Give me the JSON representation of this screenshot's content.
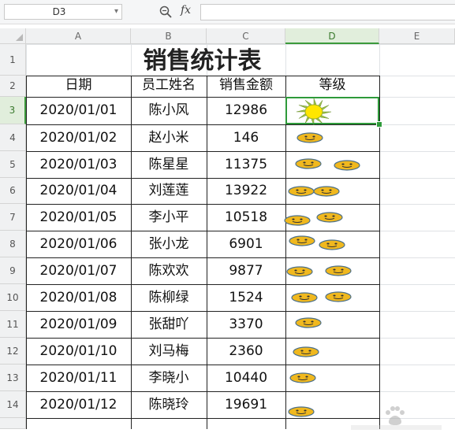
{
  "formula_bar": {
    "name_box": "D3",
    "fx_label": "fx",
    "formula_value": ""
  },
  "columns": [
    "A",
    "B",
    "C",
    "D",
    "E"
  ],
  "row_numbers": [
    "1",
    "2",
    "3",
    "4",
    "5",
    "6",
    "7",
    "8",
    "9",
    "10",
    "11",
    "12",
    "13",
    "14"
  ],
  "sheet": {
    "title": "销售统计表",
    "headers": [
      "日期",
      "员工姓名",
      "销售金额",
      "等级"
    ],
    "rows": [
      {
        "date": "2020/01/01",
        "name": "陈小风",
        "amount": "12986"
      },
      {
        "date": "2020/01/02",
        "name": "赵小米",
        "amount": "146"
      },
      {
        "date": "2020/01/03",
        "name": "陈星星",
        "amount": "11375"
      },
      {
        "date": "2020/01/04",
        "name": "刘莲莲",
        "amount": "13922"
      },
      {
        "date": "2020/01/05",
        "name": "李小平",
        "amount": "10518"
      },
      {
        "date": "2020/01/06",
        "name": "张小龙",
        "amount": "6901"
      },
      {
        "date": "2020/01/07",
        "name": "陈欢欢",
        "amount": "9877"
      },
      {
        "date": "2020/01/08",
        "name": "陈柳绿",
        "amount": "1524"
      },
      {
        "date": "2020/01/09",
        "name": "张甜吖",
        "amount": "3370"
      },
      {
        "date": "2020/01/10",
        "name": "刘马梅",
        "amount": "2360"
      },
      {
        "date": "2020/01/11",
        "name": "李晓小",
        "amount": "10440"
      },
      {
        "date": "2020/01/12",
        "name": "陈晓玲",
        "amount": "19691"
      }
    ],
    "grade_shapes": [
      [
        "sun"
      ],
      [
        "smiley"
      ],
      [
        "smiley",
        "smiley"
      ],
      [
        "smiley",
        "smiley"
      ],
      [
        "smiley",
        "smiley"
      ],
      [
        "smiley",
        "smiley"
      ],
      [
        "smiley",
        "smiley"
      ],
      [
        "smiley",
        "smiley"
      ],
      [
        "smiley"
      ],
      [
        "smiley"
      ],
      [
        "smiley"
      ],
      [
        "smiley"
      ]
    ]
  },
  "colors": {
    "selection": "#2e9a3a",
    "smiley_fill": "#f0b81e",
    "smiley_stroke": "#4a6f8a",
    "sun_fill": "#ffe600",
    "sun_rays": "#9cc24a"
  },
  "icons": {
    "zoom": "zoom-formula-icon",
    "fx": "fx-icon",
    "dropdown": "chevron-down-icon"
  }
}
